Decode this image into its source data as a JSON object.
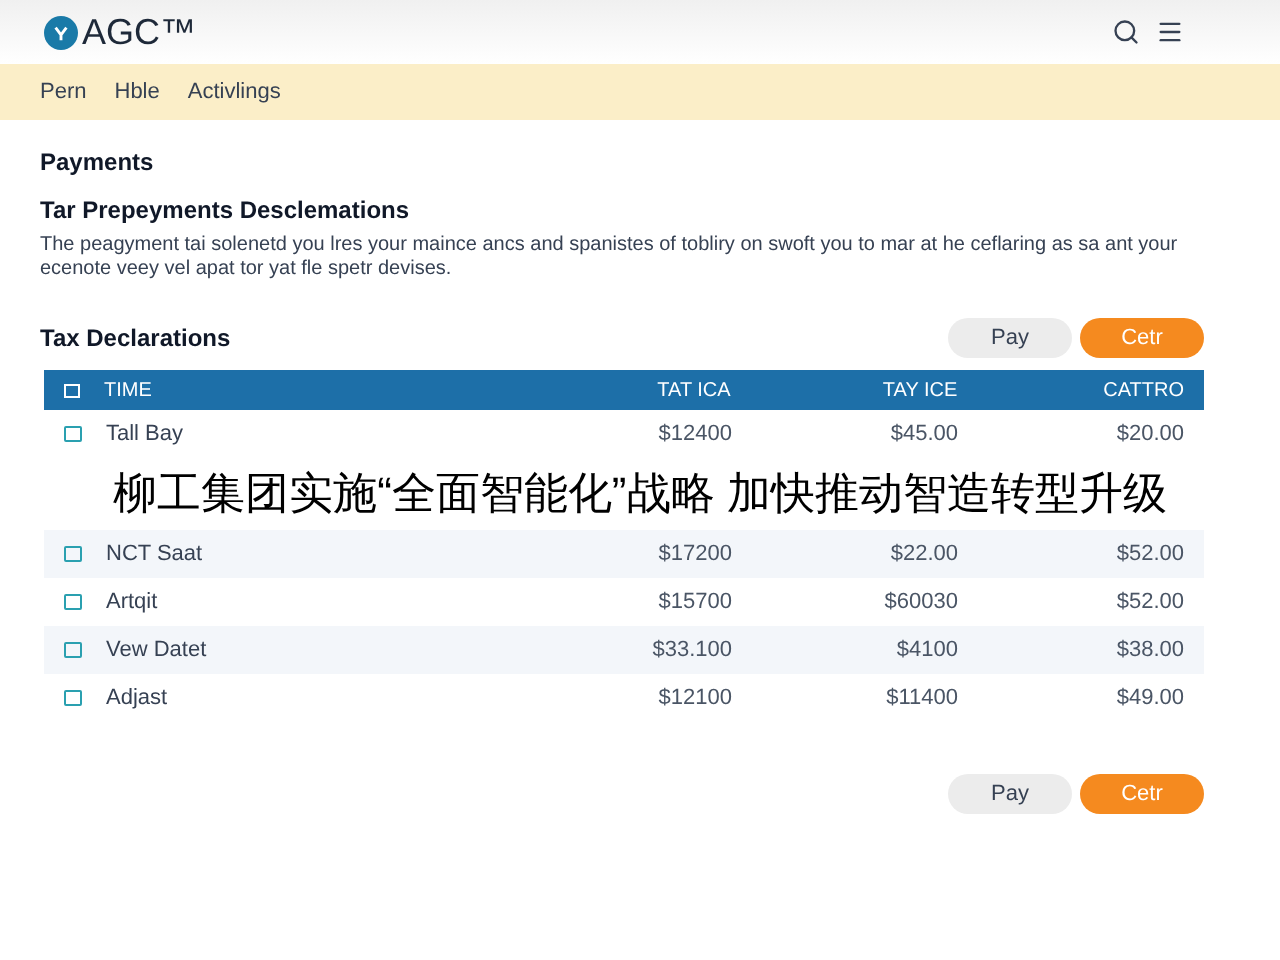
{
  "header": {
    "logo": "AGC™"
  },
  "nav": [
    "Pern",
    "Hble",
    "Activlings"
  ],
  "section": {
    "title": "Payments",
    "subtitle": "Tar Prepeyments Desclemations",
    "description": "The peagyment tai solenetd you lres your maince ancs and spanistes of tobliry on swoft you to mar at he ceflaring as sa ant your ecenote veey vel apat tor yat fle spetr devises."
  },
  "table": {
    "title": "Tax Declarations",
    "buttons": [
      {
        "label": "Pay",
        "kind": "secondary"
      },
      {
        "label": "Cetr",
        "kind": "primary"
      }
    ],
    "columns": [
      "TIME",
      "TAT ICA",
      "TAY ICE",
      "CATTRO"
    ],
    "rows_before_caption": [
      [
        "Tall Bay",
        "$12400",
        "$45.00",
        "$20.00"
      ]
    ],
    "rows_after_caption": [
      [
        "NCT Saat",
        "$17200",
        "$22.00",
        "$52.00"
      ],
      [
        "Artqit",
        "$15700",
        "$60030",
        "$52.00"
      ],
      [
        "Vew Datet",
        "$33.100",
        "$4100",
        "$38.00"
      ],
      [
        "Adjast",
        "$12100",
        "$11400",
        "$49.00"
      ]
    ]
  },
  "caption": "柳工集团实施“全面智能化”战略 加快推动智造转型升级",
  "footer_buttons": [
    {
      "label": "Pay",
      "kind": "secondary"
    },
    {
      "label": "Cetr",
      "kind": "primary"
    }
  ]
}
